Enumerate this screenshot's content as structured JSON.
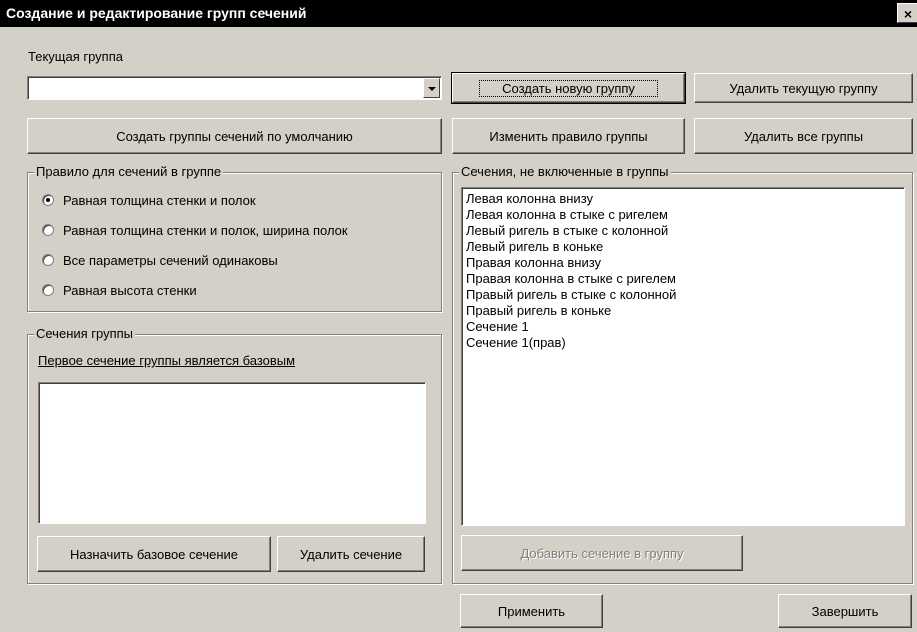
{
  "window": {
    "title": "Создание и редактирование групп сечений",
    "close_glyph": "×"
  },
  "current_group": {
    "label": "Текущая группа",
    "value": ""
  },
  "buttons": {
    "create_new_group": "Создать новую группу",
    "delete_current_group": "Удалить текущую группу",
    "create_default_groups": "Создать группы сечений по умолчанию",
    "change_group_rule": "Изменить правило группы",
    "delete_all_groups": "Удалить все группы",
    "assign_base_section": "Назначить базовое сечение",
    "delete_section": "Удалить сечение",
    "add_section_to_group": "Добавить сечение в группу",
    "apply": "Применить",
    "finish": "Завершить"
  },
  "rule_group": {
    "title": "Правило для сечений в группе",
    "options": [
      {
        "label": "Равная толщина стенки и полок",
        "checked": true
      },
      {
        "label": "Равная толщина стенки и полок, ширина полок",
        "checked": false
      },
      {
        "label": "Все параметры сечений одинаковы",
        "checked": false
      },
      {
        "label": "Равная высота стенки",
        "checked": false
      }
    ]
  },
  "group_sections": {
    "title": "Сечения группы",
    "hint": "Первое сечение группы является базовым",
    "items": []
  },
  "ungrouped_sections": {
    "title": "Сечения, не включенные в группы",
    "items": [
      "Левая колонна внизу",
      "Левая колонна в стыке с ригелем",
      "Левый ригель в стыке с колонной",
      "Левый ригель в коньке",
      "Правая колонна внизу",
      "Правая колонна в стыке с ригелем",
      "Правый ригель в стыке с колонной",
      "Правый ригель в коньке",
      "Сечение 1",
      "Сечение 1(прав)"
    ]
  },
  "colors": {
    "face": "#d4d0c8",
    "titlebar": "#000000"
  }
}
